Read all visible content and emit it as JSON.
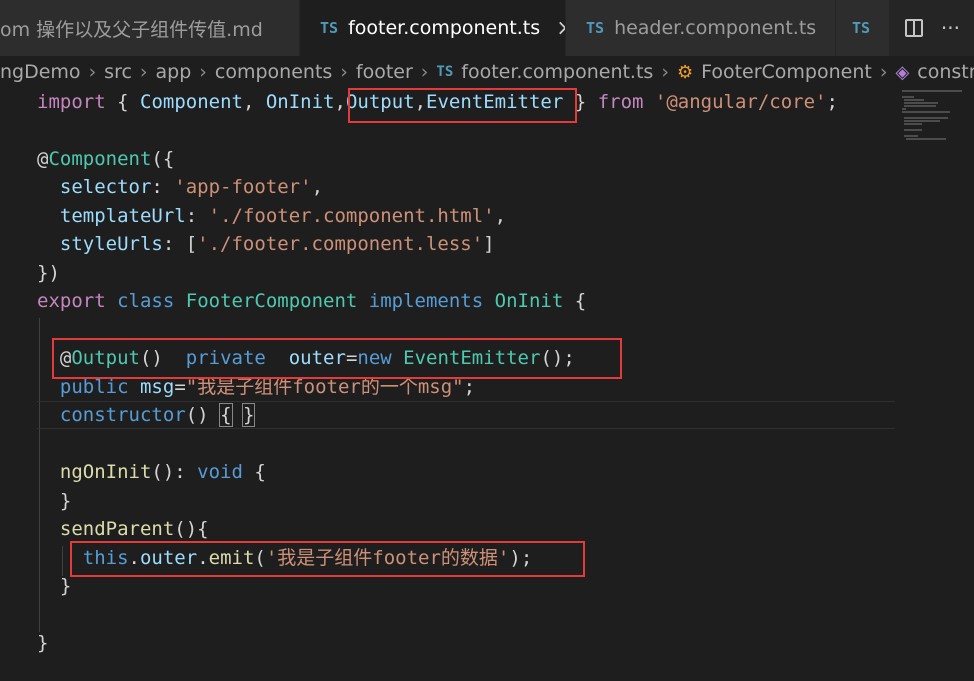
{
  "tabs": [
    {
      "label": "om 操作以及父子组件传值.md",
      "type": "md",
      "active": false
    },
    {
      "label": "footer.component.ts",
      "type": "ts",
      "active": true,
      "close": "×"
    },
    {
      "label": "header.component.ts",
      "type": "ts",
      "active": false
    },
    {
      "label": "",
      "type": "ts",
      "active": false
    }
  ],
  "ts_badge": "TS",
  "actions": {
    "split": "split-editor-icon",
    "more": "···"
  },
  "breadcrumb": [
    "ngDemo",
    "src",
    "app",
    "components",
    "footer",
    "footer.component.ts",
    "FooterComponent",
    "constructor"
  ],
  "code": {
    "l1": {
      "import": "import",
      "ob": "{",
      "component": "Component",
      "comma1": ",",
      "oninit": "OnInit",
      "comma2": ",",
      "output": "Output",
      "comma3": ",",
      "emitter": "EventEmitter",
      "cb": "}",
      "from": "from",
      "module": "'@angular/core'",
      "semi": ";"
    },
    "l3": {
      "at": "@",
      "name": "Component",
      "paren": "({"
    },
    "l4": {
      "key": "selector",
      "colon": ": ",
      "val": "'app-footer'",
      "comma": ","
    },
    "l5": {
      "key": "templateUrl",
      "colon": ": ",
      "val": "'./footer.component.html'",
      "comma": ","
    },
    "l6": {
      "key": "styleUrls",
      "colon": ": [",
      "val": "'./footer.component.less'",
      "close": "]"
    },
    "l7": {
      "close": "})"
    },
    "l8": {
      "export": "export",
      "class": "class",
      "name": "FooterComponent",
      "implements": "implements",
      "iface": "OnInit",
      "brace": "{"
    },
    "l10": {
      "at": "@",
      "dec": "Output",
      "parens": "()",
      "private": "private",
      "prop": "outer",
      "eq": "=",
      "new": "new",
      "type": "EventEmitter",
      "end": "();"
    },
    "l11": {
      "public": "public",
      "prop": "msg",
      "eq": "=",
      "val": "\"我是子组件footer的一个msg\"",
      "semi": ";"
    },
    "l12": {
      "fn": "constructor",
      "parens": "() ",
      "ob": "{",
      "sp": " ",
      "cb": "}"
    },
    "l14": {
      "fn": "ngOnInit",
      "parens": "(): ",
      "void": "void",
      "brace": " {"
    },
    "l15": {
      "close": "}"
    },
    "l16": {
      "fn": "sendParent",
      "parens": "(){"
    },
    "l17": {
      "this": "this",
      "dot1": ".",
      "outer": "outer",
      "dot2": ".",
      "emit": "emit",
      "po": "(",
      "val": "'我是子组件footer的数据'",
      "pc": ");"
    },
    "l18": {
      "close": "}"
    },
    "l20": {
      "close": "}"
    }
  }
}
